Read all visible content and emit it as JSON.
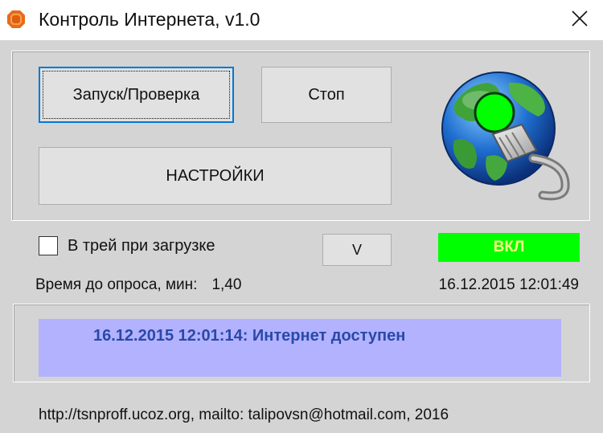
{
  "window": {
    "title": "Контроль Интернета, v1.0",
    "icon": "app-octagon-icon",
    "close_icon": "close-icon"
  },
  "buttons": {
    "start_label": "Запуск/Проверка",
    "stop_label": "Стоп",
    "settings_label": "НАСТРОЙКИ",
    "v_label": "V"
  },
  "tray": {
    "label": "В трей при загрузке",
    "checked": false
  },
  "status": {
    "text": "ВКЛ",
    "background": "#00ff00",
    "text_color": "#ffff80"
  },
  "poll": {
    "label": "Время до опроса, мин:",
    "value": "1,40"
  },
  "clock": {
    "datetime": "16.12.2015 12:01:49"
  },
  "log": {
    "message": "16.12.2015 12:01:14: Интернет доступен",
    "background": "#b2b2ff",
    "text_color": "#2a49a8"
  },
  "footer": {
    "text": "http://tsnproff.ucoz.org, mailto: talipovsn@hotmail.com, 2016"
  },
  "colors": {
    "window_bg": "#d4d4d4",
    "titlebar_bg": "#ffffff",
    "indicator_green": "#00ff00"
  }
}
